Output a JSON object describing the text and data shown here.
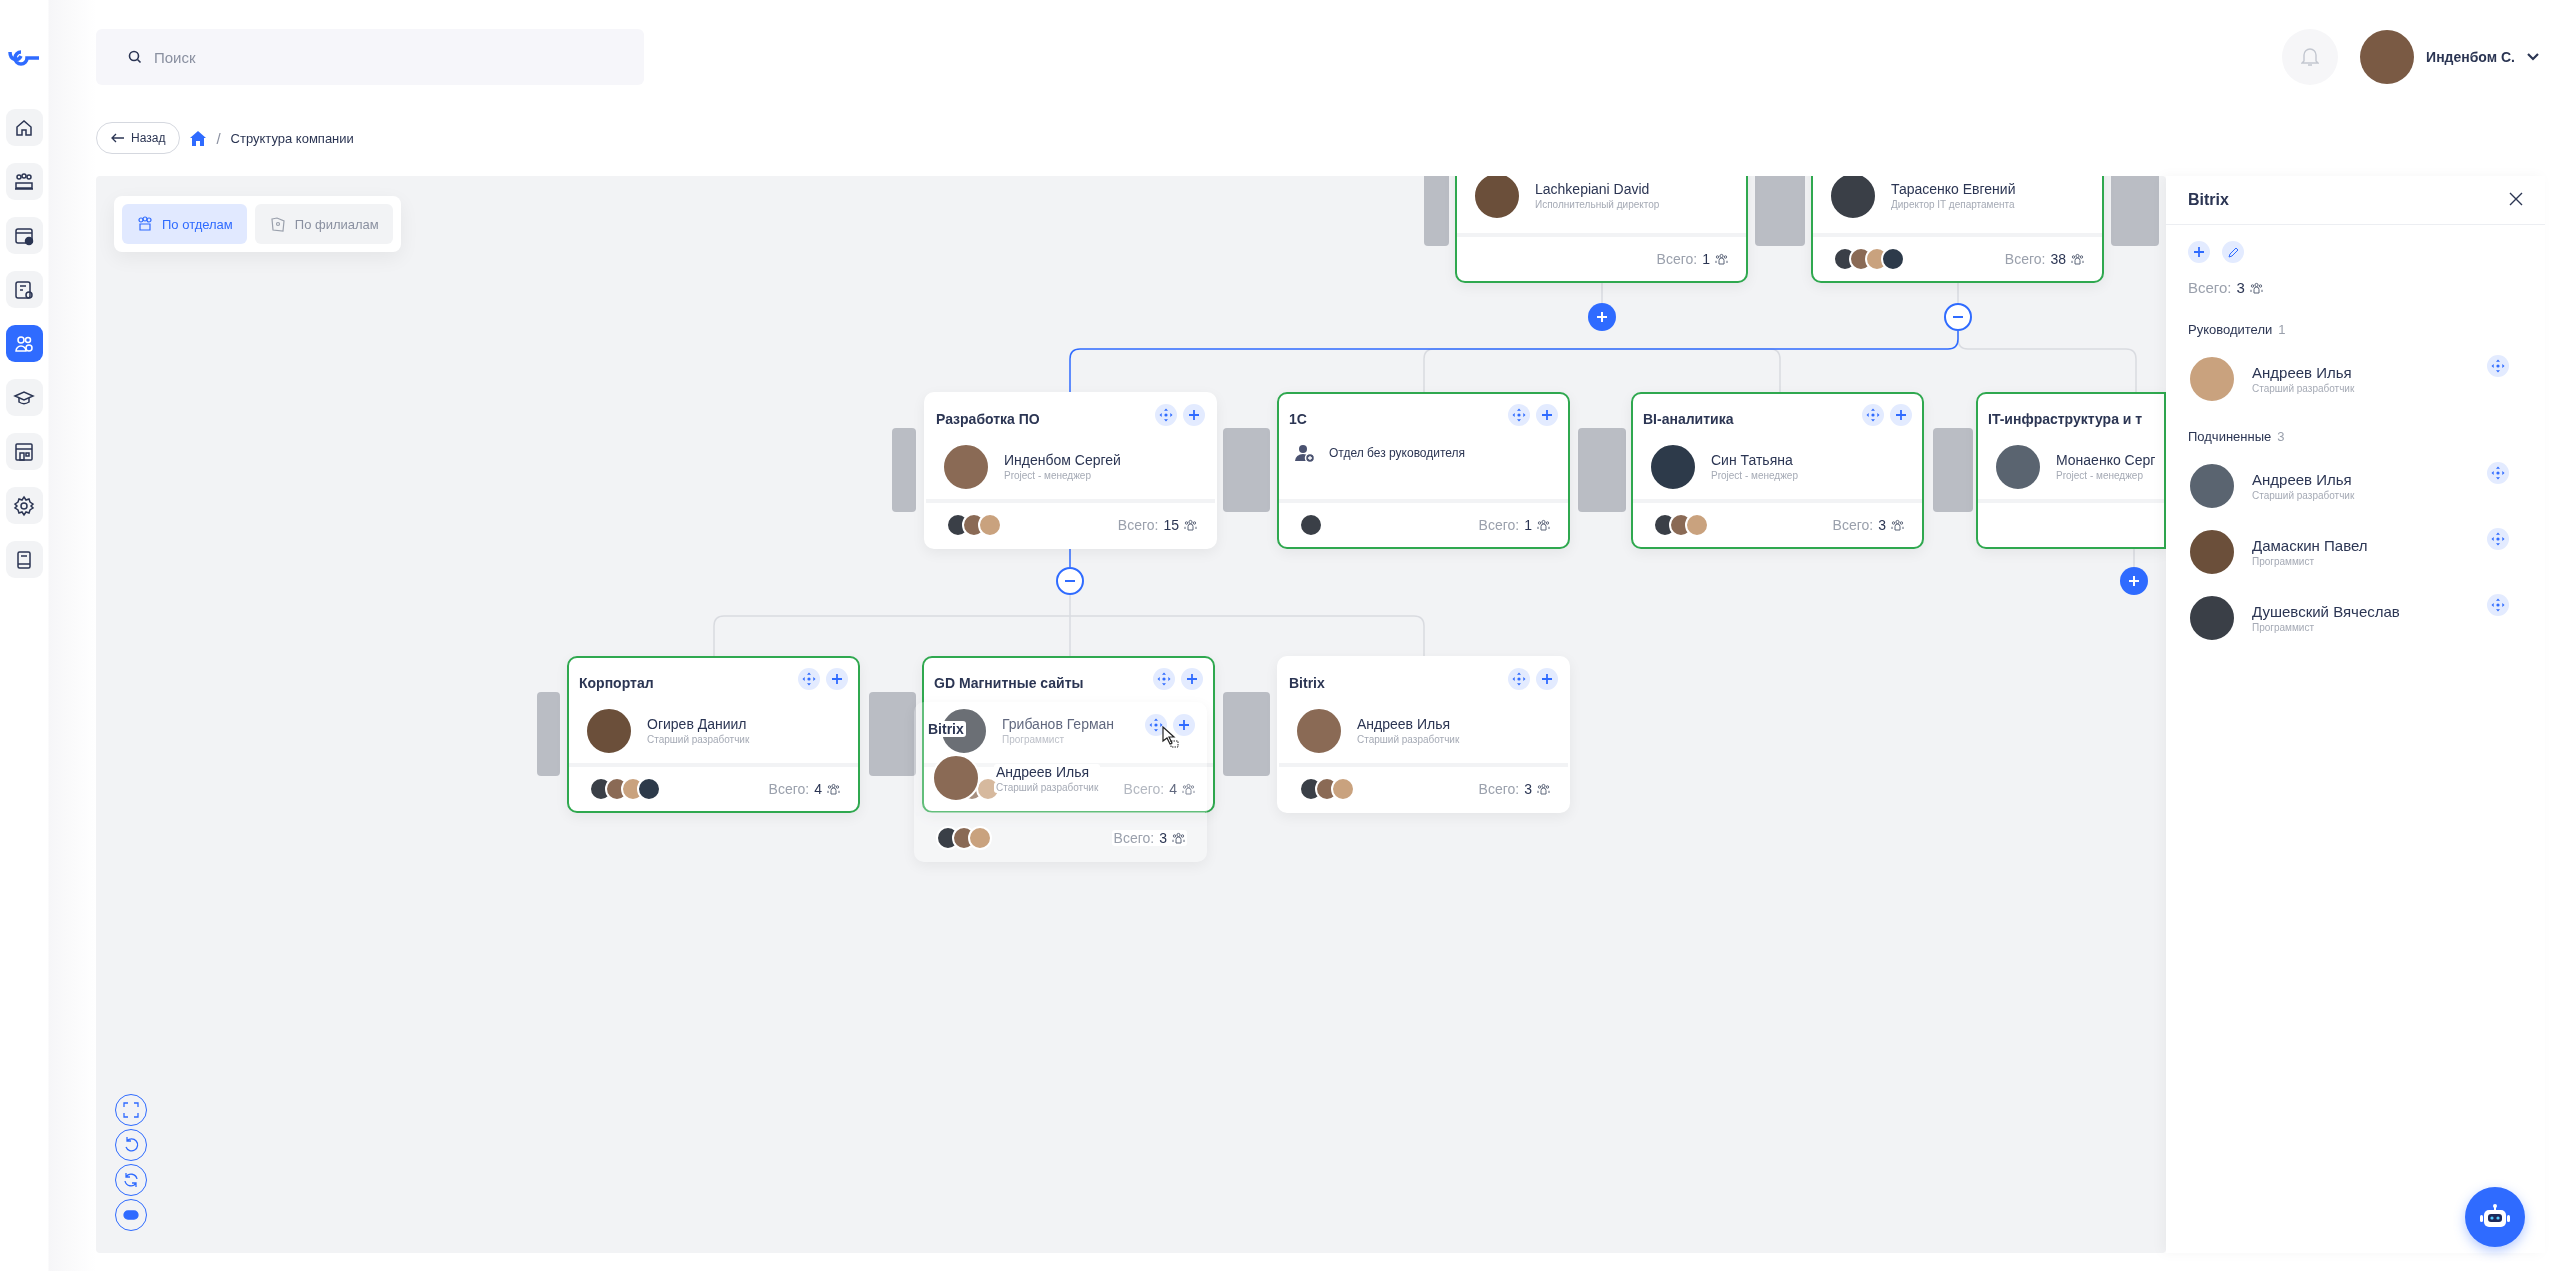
{
  "sidebar": {
    "items": [
      {
        "selected": false
      },
      {
        "selected": false
      },
      {
        "selected": false
      },
      {
        "selected": false
      },
      {
        "selected": true
      },
      {
        "selected": false
      },
      {
        "selected": false
      },
      {
        "selected": false
      },
      {
        "selected": false
      }
    ]
  },
  "search": {
    "placeholder": "Поиск"
  },
  "user": {
    "name": "Инденбом С."
  },
  "breadcrumb": {
    "back": "Назад",
    "separator": "/",
    "current": "Структура компании"
  },
  "view_tabs": [
    {
      "label": "По отделам",
      "selected": true
    },
    {
      "label": "По филиалам",
      "selected": false
    }
  ],
  "org_chart": {
    "cards": [
      {
        "highlighted": true,
        "head": {
          "kind": "person",
          "name": "Lachkepiani David",
          "role": "Исполнительный директор"
        },
        "total_label": "Всего:",
        "total": "1",
        "expanded": false
      },
      {
        "highlighted": true,
        "head": {
          "kind": "person",
          "name": "Тарасенко Евгений",
          "role": "Директор IT департамента"
        },
        "total_label": "Всего:",
        "total": "38",
        "expanded": true
      },
      {
        "title": "Разработка ПО",
        "highlighted": false,
        "head": {
          "kind": "person",
          "name": "Инденбом Сергей",
          "role": "Project - менеджер"
        },
        "total_label": "Всего:",
        "total": "15",
        "expanded": true
      },
      {
        "title": "1С",
        "highlighted": true,
        "head": {
          "kind": "vacant",
          "text": "Отдел без руководителя"
        },
        "total_label": "Всего:",
        "total": "1"
      },
      {
        "title": "BI-аналитика",
        "highlighted": true,
        "head": {
          "kind": "person",
          "name": "Син Татьяна",
          "role": "Project - менеджер"
        },
        "total_label": "Всего:",
        "total": "3"
      },
      {
        "title": "IT-инфраструктура и т",
        "highlighted": true,
        "head": {
          "kind": "person",
          "name": "Монаенко Серг",
          "role": "Project - менеджер"
        },
        "expanded": false
      },
      {
        "title": "Корпортал",
        "highlighted": true,
        "head": {
          "kind": "person",
          "name": "Огирев Даниил",
          "role": "Старший разработчик"
        },
        "total_label": "Всего:",
        "total": "4"
      },
      {
        "title": "GD Магнитные сайты",
        "highlighted": true,
        "head": {
          "kind": "person",
          "name": "Грибанов Герман",
          "role": "Программист"
        },
        "total_label": "Всего:",
        "total": "4"
      },
      {
        "title": "Bitrix",
        "highlighted": false,
        "head": {
          "kind": "person",
          "name": "Андреев Илья",
          "role": "Старший разработчик"
        },
        "total_label": "Всего:",
        "total": "3"
      }
    ],
    "drag_preview": {
      "title": "Bitrix",
      "head": {
        "kind": "person",
        "name": "Андреев Илья",
        "role": "Старший разработчик"
      },
      "total_label": "Всего:",
      "total": "3"
    }
  },
  "panel": {
    "title": "Bitrix",
    "total_label": "Всего:",
    "total": "3",
    "sections": [
      {
        "title": "Руководители",
        "count": "1",
        "people": [
          {
            "name": "Андреев Илья",
            "role": "Старший разработчик"
          }
        ]
      },
      {
        "title": "Подчиненные",
        "count": "3",
        "people": [
          {
            "name": "Андреев Илья",
            "role": "Старший разработчик"
          },
          {
            "name": "Дамаскин Павел",
            "role": "Программист"
          },
          {
            "name": "Душевский Вячеслав",
            "role": "Программист"
          }
        ]
      }
    ]
  }
}
